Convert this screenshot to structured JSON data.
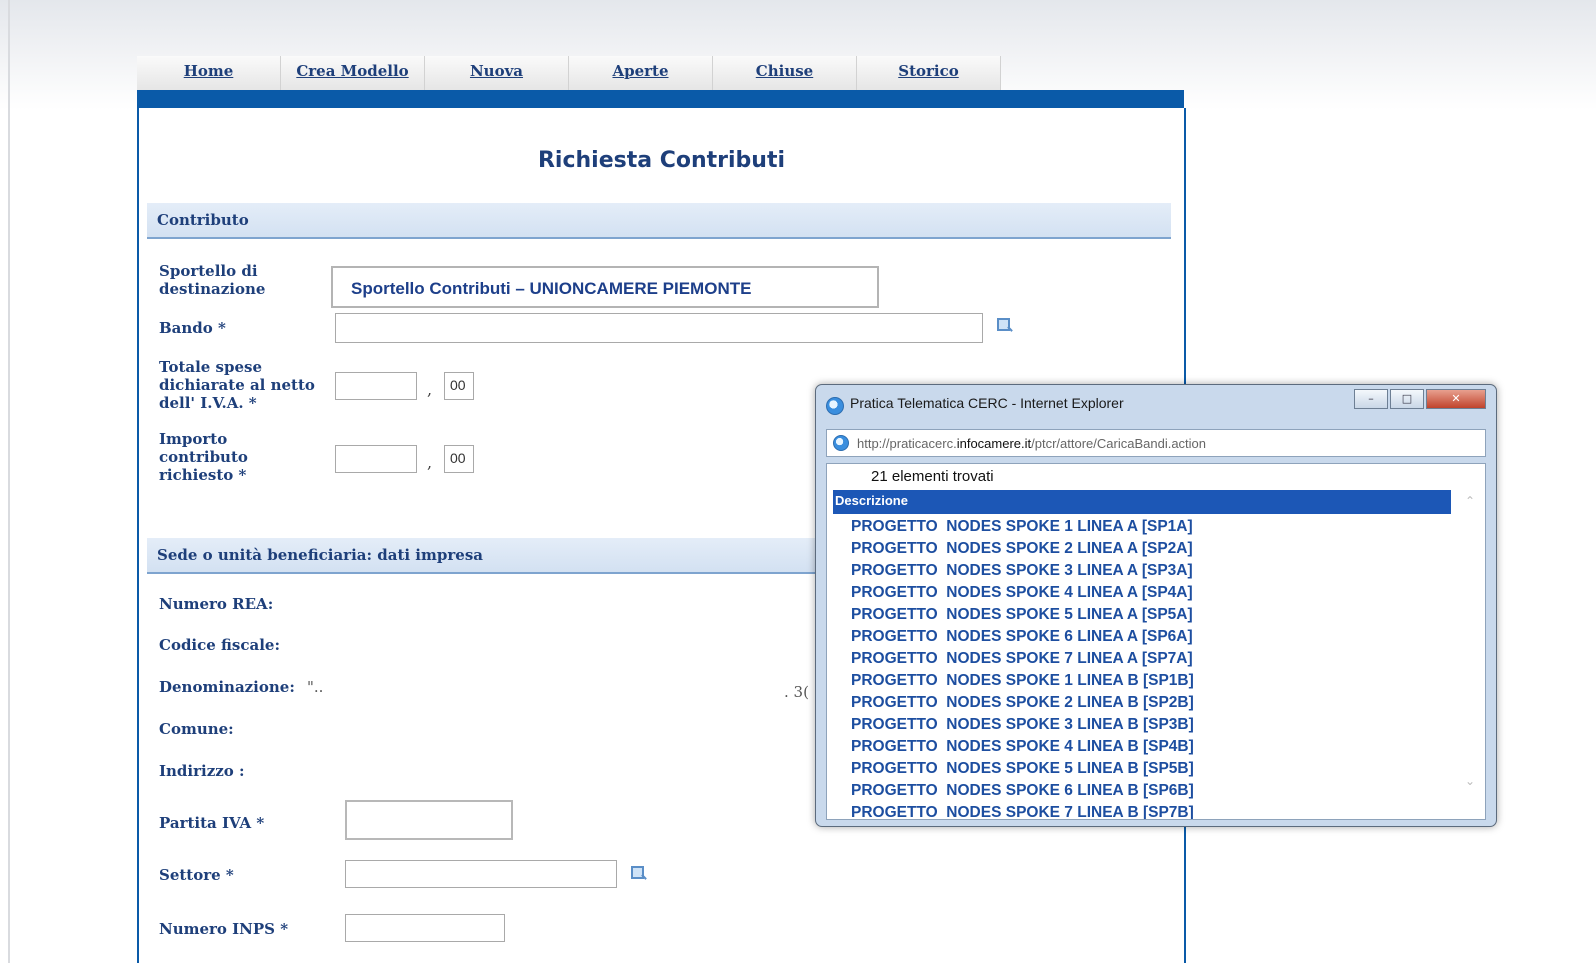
{
  "nav": {
    "tabs": [
      "Home",
      "Crea Modello",
      "Nuova",
      "Aperte",
      "Chiuse",
      "Storico"
    ]
  },
  "page": {
    "title": "Richiesta Contributi"
  },
  "contributo": {
    "section_label": "Contributo",
    "sportello_label": "Sportello di destinazione",
    "sportello_value": "Sportello Contributi – UNIONCAMERE PIEMONTE",
    "bando_label": "Bando *",
    "totale_label": "Totale spese dichiarate al netto dell' I.V.A. *",
    "totale_decimals": "00",
    "importo_label": "Importo contributo richiesto *",
    "importo_decimals": "00",
    "comma": ","
  },
  "sede": {
    "section_label": "Sede o unità beneficiaria: dati impresa",
    "rea_label": "Numero REA:",
    "cf_label": "Codice fiscale:",
    "denominazione_label": "Denominazione:",
    "denominazione_value": "\"..",
    "partial_value": ". 3(",
    "comune_label": "Comune:",
    "indirizzo_label": "Indirizzo :",
    "piva_label": "Partita IVA *",
    "settore_label": "Settore *",
    "inps_label": "Numero INPS *"
  },
  "popup": {
    "title": "Pratica Telematica CERC - Internet Explorer",
    "url_prefix": "http://praticacerc.",
    "url_host": "infocamere.it",
    "url_path": "/ptcr/attore/CaricaBandi.action",
    "count_text": "21 elementi trovati",
    "column_header": "Descrizione",
    "items": [
      "PROGETTO  NODES SPOKE 1 LINEA A [SP1A]",
      "PROGETTO  NODES SPOKE 2 LINEA A [SP2A]",
      "PROGETTO  NODES SPOKE 3 LINEA A [SP3A]",
      "PROGETTO  NODES SPOKE 4 LINEA A [SP4A]",
      "PROGETTO  NODES SPOKE 5 LINEA A [SP5A]",
      "PROGETTO  NODES SPOKE 6 LINEA A [SP6A]",
      "PROGETTO  NODES SPOKE 7 LINEA A [SP7A]",
      "PROGETTO  NODES SPOKE 1 LINEA B [SP1B]",
      "PROGETTO  NODES SPOKE 2 LINEA B [SP2B]",
      "PROGETTO  NODES SPOKE 3 LINEA B [SP3B]",
      "PROGETTO  NODES SPOKE 4 LINEA B [SP4B]",
      "PROGETTO  NODES SPOKE 5 LINEA B [SP5B]",
      "PROGETTO  NODES SPOKE 6 LINEA B [SP6B]",
      "PROGETTO  NODES SPOKE 7 LINEA B [SP7B]"
    ],
    "icons": {
      "minimize": "minimize-icon",
      "maximize": "maximize-icon",
      "close": "close-icon",
      "scroll_up": "chevron-up-icon",
      "scroll_down": "chevron-down-icon"
    }
  },
  "colors": {
    "nav_bar": "#0a5aa8",
    "label_text": "#1e3f7a",
    "list_text": "#1d4ea0",
    "list_header": "#1c57b6"
  }
}
